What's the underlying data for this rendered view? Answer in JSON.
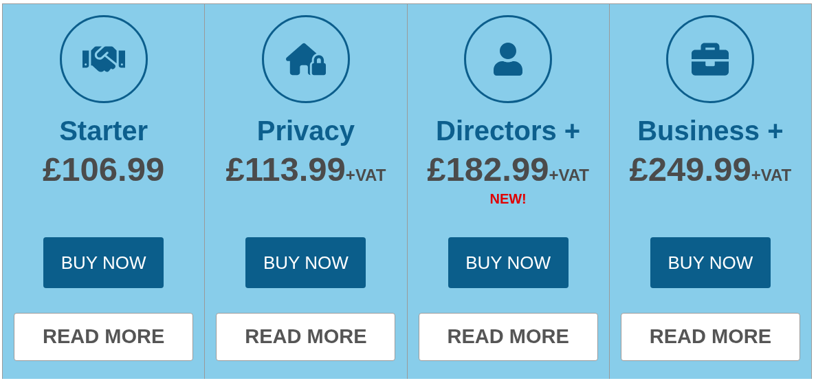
{
  "plans": [
    {
      "kind": "handshake",
      "title": "Starter",
      "price": "£106.99",
      "buy_label": "BUY NOW",
      "more_label": "READ MORE"
    },
    {
      "kind": "house-lock",
      "title": "Privacy",
      "price": "£113.99",
      "vat_note": "+VAT",
      "buy_label": "BUY NOW",
      "more_label": "READ MORE"
    },
    {
      "kind": "person",
      "title": "Directors +",
      "price": "£182.99",
      "vat_note": "+VAT",
      "badge": "NEW!",
      "buy_label": "BUY NOW",
      "more_label": "READ MORE"
    },
    {
      "kind": "briefcase",
      "title": "Business +",
      "price": "£249.99",
      "vat_note": "+VAT",
      "buy_label": "BUY NOW",
      "more_label": "READ MORE"
    }
  ]
}
